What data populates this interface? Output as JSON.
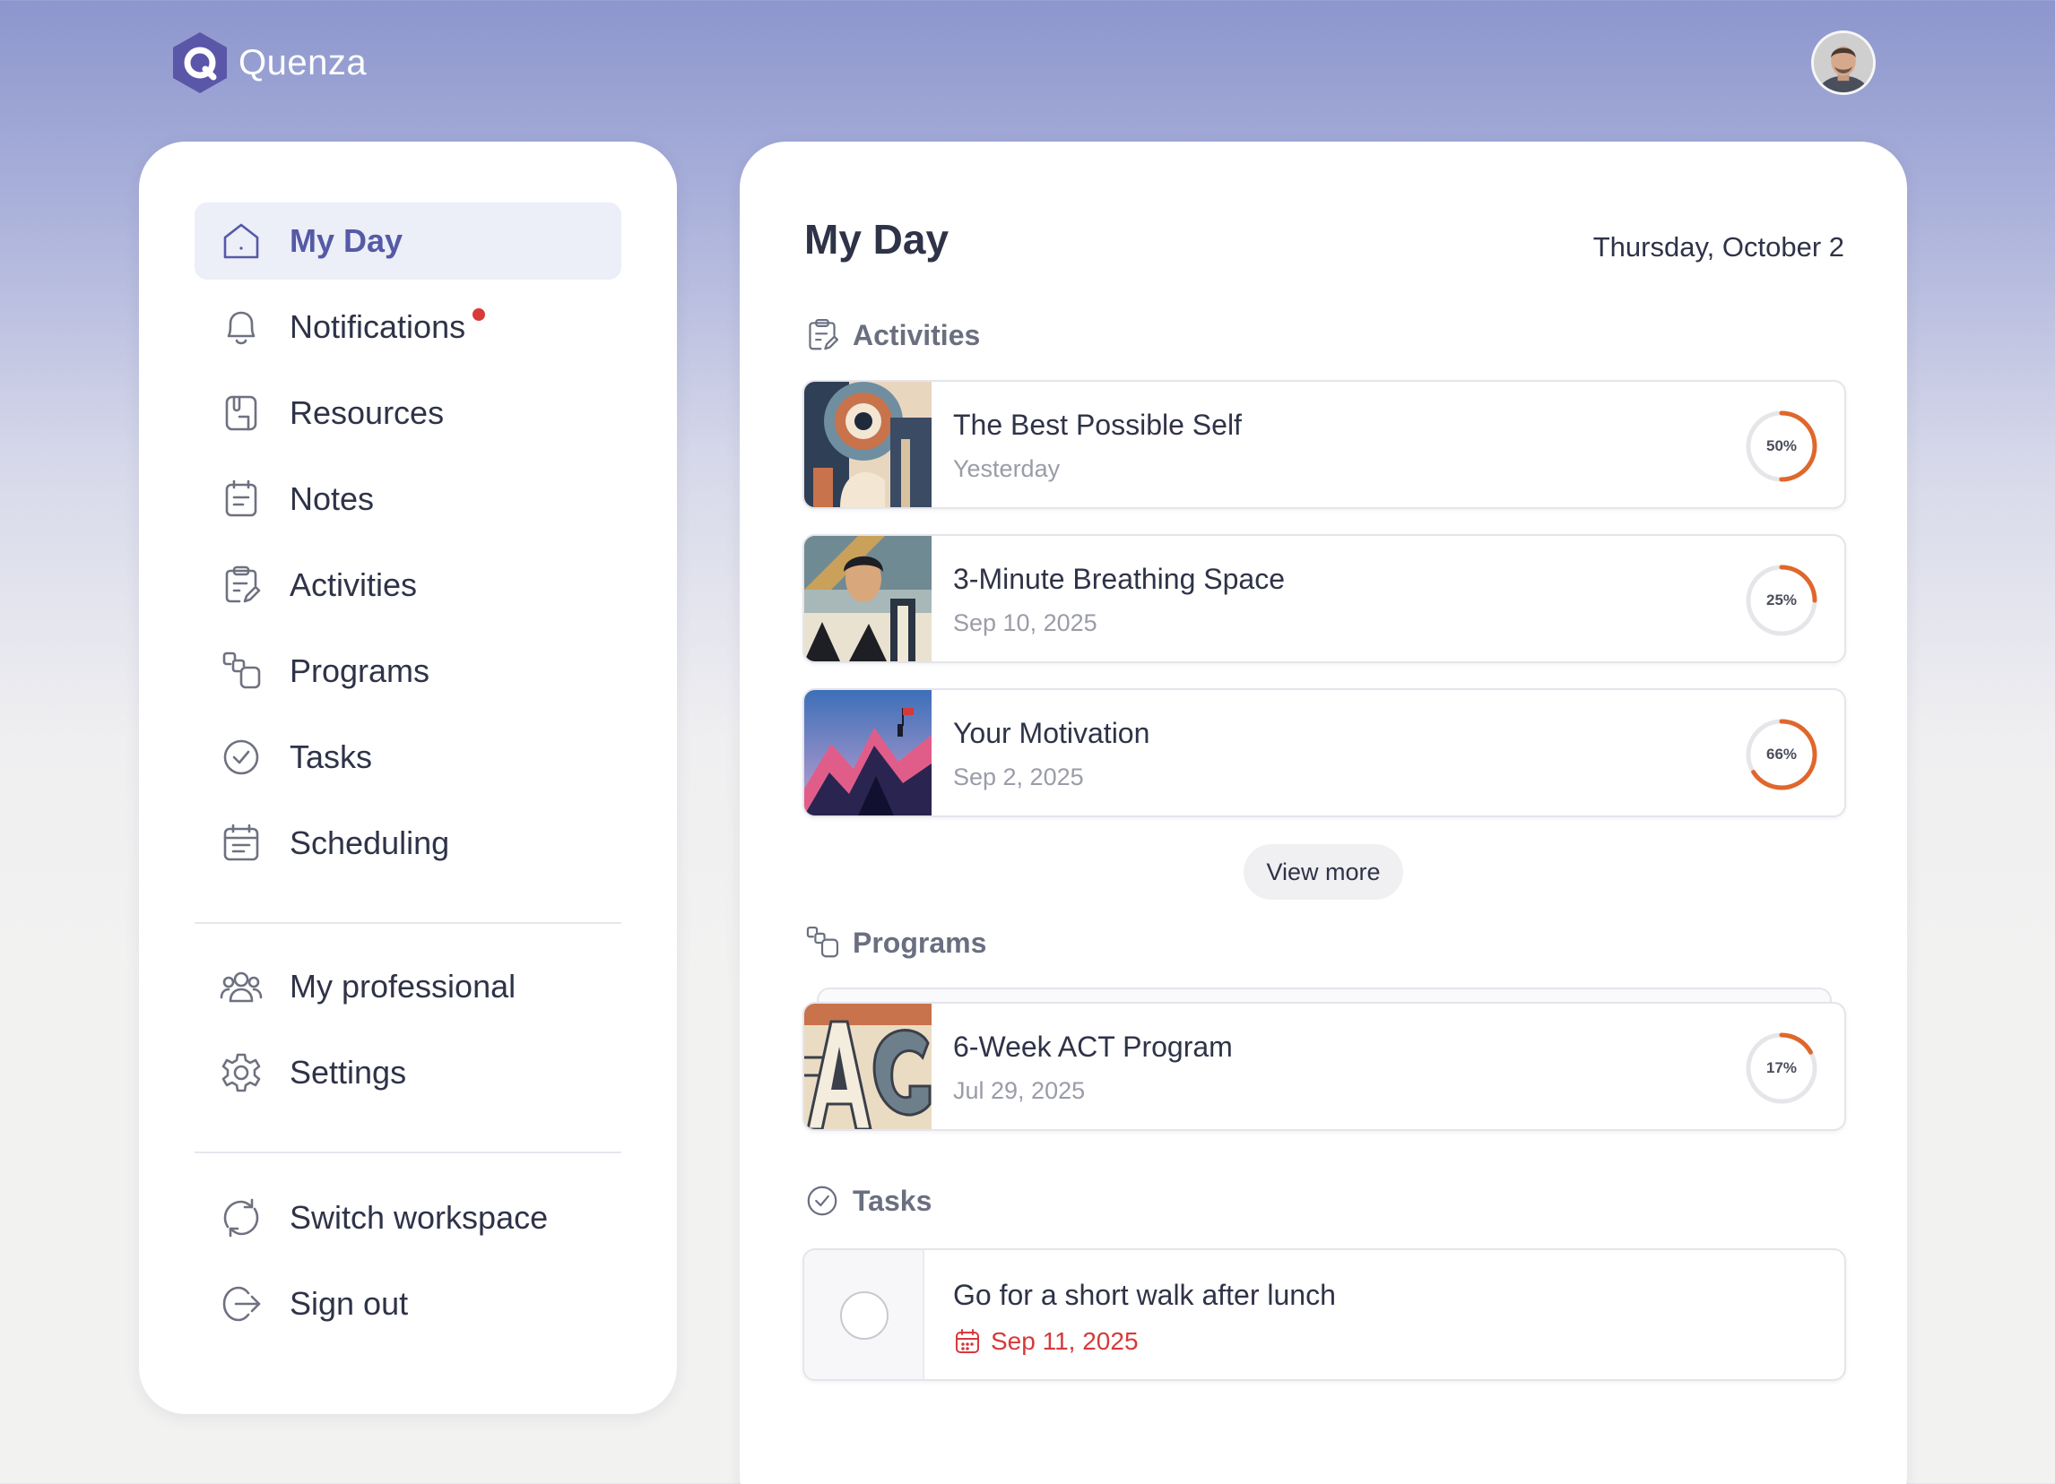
{
  "app": {
    "name": "Quenza"
  },
  "sidebar": {
    "items": [
      {
        "label": "My Day",
        "icon": "home-icon",
        "active": true
      },
      {
        "label": "Notifications",
        "icon": "bell-icon",
        "has_unread": true
      },
      {
        "label": "Resources",
        "icon": "resources-icon"
      },
      {
        "label": "Notes",
        "icon": "notes-icon"
      },
      {
        "label": "Activities",
        "icon": "clipboard-icon"
      },
      {
        "label": "Programs",
        "icon": "programs-icon"
      },
      {
        "label": "Tasks",
        "icon": "check-circle-icon"
      },
      {
        "label": "Scheduling",
        "icon": "calendar-icon"
      }
    ],
    "secondary": [
      {
        "label": "My professional",
        "icon": "users-icon"
      },
      {
        "label": "Settings",
        "icon": "gear-icon"
      }
    ],
    "account": [
      {
        "label": "Switch workspace",
        "icon": "refresh-icon"
      },
      {
        "label": "Sign out",
        "icon": "sign-out-icon"
      }
    ]
  },
  "main": {
    "title": "My Day",
    "date": "Thursday, October 2",
    "activities": {
      "heading": "Activities",
      "items": [
        {
          "title": "The Best Possible Self",
          "subtitle": "Yesterday",
          "progress_label": "50%",
          "progress": 0.5
        },
        {
          "title": "3-Minute Breathing Space",
          "subtitle": "Sep 10, 2025",
          "progress_label": "25%",
          "progress": 0.25
        },
        {
          "title": "Your Motivation",
          "subtitle": "Sep 2, 2025",
          "progress_label": "66%",
          "progress": 0.66
        }
      ],
      "view_more_label": "View more"
    },
    "programs": {
      "heading": "Programs",
      "items": [
        {
          "title": "6-Week ACT Program",
          "subtitle": "Jul 29, 2025",
          "progress_label": "17%",
          "progress": 0.17
        }
      ]
    },
    "tasks": {
      "heading": "Tasks",
      "items": [
        {
          "title": "Go for a short walk after lunch",
          "due": "Sep 11, 2025",
          "overdue": true
        }
      ]
    }
  },
  "colors": {
    "accent": "#555aa6",
    "progress": "#e0672c",
    "overdue": "#d6393b",
    "notification_dot": "#d83a3a"
  }
}
